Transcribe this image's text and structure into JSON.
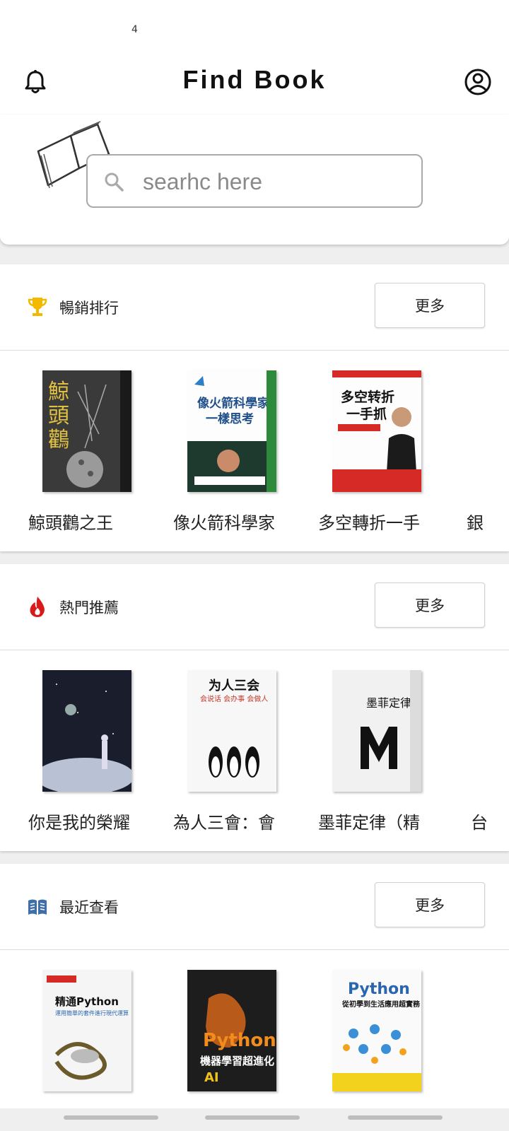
{
  "status": {
    "notification_count": "4"
  },
  "header": {
    "title": "Find Book",
    "bell_icon": "bell-icon",
    "profile_icon": "account-circle-icon"
  },
  "search": {
    "placeholder": "searhc here"
  },
  "sections": [
    {
      "title": "暢銷排行",
      "icon": "trophy-icon",
      "icon_color": "#f5b800",
      "more_label": "更多",
      "books": [
        {
          "title": "鯨頭鸛之王",
          "cover_color": "#3b3b3b",
          "spine_color": "#222222"
        },
        {
          "title": "像火箭科學家",
          "cover_color": "#2c7fc6",
          "spine_color": "#1f5f9a"
        },
        {
          "title": "多空轉折一手",
          "cover_color": "#d52a26",
          "spine_color": "#b01f1c"
        },
        {
          "title": "銀",
          "cover_color": "#888888",
          "spine_color": "#666666"
        }
      ]
    },
    {
      "title": "熱門推薦",
      "icon": "fire-icon",
      "icon_color": "#d91a1a",
      "more_label": "更多",
      "books": [
        {
          "title": "你是我的榮耀",
          "cover_color": "#1a1d2b",
          "spine_color": "#0f1119"
        },
        {
          "title": "為人三會：會",
          "cover_color": "#f4f4f4",
          "spine_color": "#dcdcdc"
        },
        {
          "title": "墨菲定律（精",
          "cover_color": "#efefef",
          "spine_color": "#d9d9d9"
        },
        {
          "title": "台",
          "cover_color": "#888888",
          "spine_color": "#666666"
        }
      ]
    },
    {
      "title": "最近查看",
      "icon": "book-open-icon",
      "icon_color": "#3f6fa8",
      "more_label": "更多",
      "books": [
        {
          "title": "",
          "cover_color": "#f2f2f2",
          "spine_color": "#d8d8d8"
        },
        {
          "title": "",
          "cover_color": "#1d1d1d",
          "spine_color": "#111111"
        },
        {
          "title": "",
          "cover_color": "#fafafa",
          "spine_color": "#e0e0e0"
        }
      ]
    }
  ]
}
